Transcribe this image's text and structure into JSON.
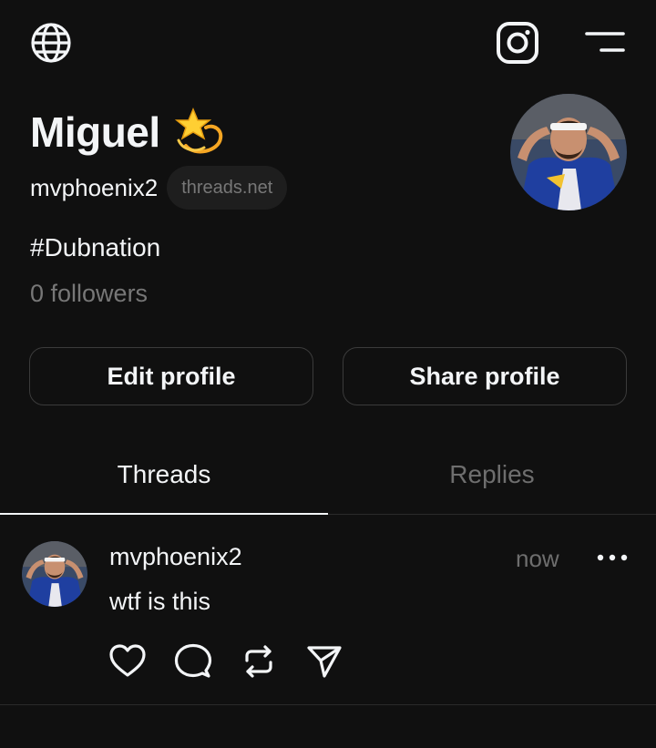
{
  "topbar": {
    "globe_icon": "globe-icon",
    "instagram_icon": "instagram-icon",
    "menu_icon": "menu-icon"
  },
  "profile": {
    "display_name": "Miguel",
    "name_emoji": "dizzy-star-emoji",
    "handle": "mvphoenix2",
    "domain": "threads.net",
    "bio": "#Dubnation",
    "followers": "0 followers"
  },
  "buttons": {
    "edit": "Edit profile",
    "share": "Share profile"
  },
  "tabs": {
    "threads": "Threads",
    "replies": "Replies",
    "active": "threads"
  },
  "post": {
    "username": "mvphoenix2",
    "time": "now",
    "text": "wtf is this",
    "actions": [
      "heart-icon",
      "comment-icon",
      "repost-icon",
      "send-icon"
    ]
  },
  "colors": {
    "background": "#101010",
    "text": "#f3f5f7",
    "muted": "#777777",
    "border": "#3b3b3b",
    "pill": "#1e1e1e"
  }
}
